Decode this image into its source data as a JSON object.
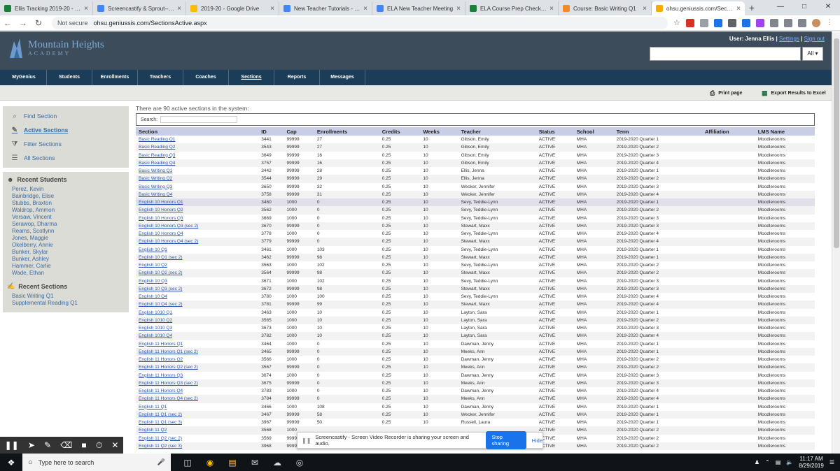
{
  "browser": {
    "tabs": [
      {
        "title": "Ellis Tracking 2019-20 - Go",
        "color": "#188038"
      },
      {
        "title": "Screencastify & Sprout--Wi",
        "color": "#4285f4"
      },
      {
        "title": "2019-20 - Google Drive",
        "color": "#fbbc04"
      },
      {
        "title": "New Teacher Tutorials - Go",
        "color": "#4285f4"
      },
      {
        "title": "ELA New Teacher Meeting",
        "color": "#4285f4"
      },
      {
        "title": "ELA Course Prep Checkoff",
        "color": "#188038"
      },
      {
        "title": "Course: Basic Writing Q1",
        "color": "#f28b27"
      },
      {
        "title": "ohsu.geniussis.com/Section",
        "color": "#f9ab00"
      }
    ],
    "not_secure": "Not secure",
    "url": "ohsu.geniussis.com/SectionsActive.aspx"
  },
  "header": {
    "logo_line1": "Mountain Heights",
    "logo_line2": "ACADEMY",
    "user_label": "User: Jenna Ellis |",
    "settings": "Settings",
    "sign_out": "Sign out",
    "search_scope": "All ▾"
  },
  "nav": [
    "MyGenius",
    "Students",
    "Enrollments",
    "Teachers",
    "Coaches",
    "Sections",
    "Reports",
    "Messages"
  ],
  "toolbar": {
    "print": "Print page",
    "export": "Export Results to Excel"
  },
  "sidebar": {
    "links": [
      {
        "label": "Find Section",
        "icon": "search-icon"
      },
      {
        "label": "Active Sections",
        "icon": "pencil-icon"
      },
      {
        "label": "Filter Sections",
        "icon": "filter-icon"
      },
      {
        "label": "All Sections",
        "icon": "list-icon"
      }
    ],
    "recent_students_title": "Recent Students",
    "recent_students": [
      "Perez, Kevin",
      "Bainbridge, Elise",
      "Stubbs, Braxton",
      "Waldrop, Ammon",
      "Versaw, Vincent",
      "Serawop, Dharma",
      "Reams, Scotlynn",
      "Jones, Maggie",
      "Okelberry, Annie",
      "Bunker, Skylar",
      "Bunker, Ashley",
      "Hammer, Carlie",
      "Wade, Ethan"
    ],
    "recent_sections_title": "Recent Sections",
    "recent_sections": [
      "Basic Writing Q1",
      "Supplemental Reading Q1"
    ]
  },
  "main": {
    "count_text": "There are 90 active sections in the system:",
    "search_label": "Search:",
    "columns": [
      "Section",
      "ID",
      "Cap",
      "Enrollments",
      "Credits",
      "Weeks",
      "Teacher",
      "Status",
      "School",
      "Term",
      "Affiliation",
      "LMS Name"
    ],
    "rows": [
      [
        "Basic Reading Q1",
        "3441",
        "99999",
        "27",
        "0.25",
        "10",
        "Gibson, Emily",
        "ACTIVE",
        "MHA",
        "2019-2020 Quarter 1",
        "",
        "Moodlerooms"
      ],
      [
        "Basic Reading Q2",
        "3543",
        "99999",
        "27",
        "0.25",
        "10",
        "Gibson, Emily",
        "ACTIVE",
        "MHA",
        "2019-2020 Quarter 2",
        "",
        "Moodlerooms"
      ],
      [
        "Basic Reading Q3",
        "3649",
        "99999",
        "16",
        "0.25",
        "10",
        "Gibson, Emily",
        "ACTIVE",
        "MHA",
        "2019-2020 Quarter 3",
        "",
        "Moodlerooms"
      ],
      [
        "Basic Reading Q4",
        "3757",
        "99999",
        "16",
        "0.25",
        "10",
        "Gibson, Emily",
        "ACTIVE",
        "MHA",
        "2019-2020 Quarter 4",
        "",
        "Moodlerooms"
      ],
      [
        "Basic Writing Q1",
        "3442",
        "99999",
        "28",
        "0.25",
        "10",
        "Ellis, Jenna",
        "ACTIVE",
        "MHA",
        "2019-2020 Quarter 1",
        "",
        "Moodlerooms"
      ],
      [
        "Basic Writing Q2",
        "3544",
        "99999",
        "29",
        "0.25",
        "10",
        "Ellis, Jenna",
        "ACTIVE",
        "MHA",
        "2019-2020 Quarter 2",
        "",
        "Moodlerooms"
      ],
      [
        "Basic Writing Q3",
        "3650",
        "99999",
        "32",
        "0.25",
        "10",
        "Wecker, Jennifer",
        "ACTIVE",
        "MHA",
        "2019-2020 Quarter 3",
        "",
        "Moodlerooms"
      ],
      [
        "Basic Writing Q4",
        "3758",
        "99999",
        "31",
        "0.25",
        "10",
        "Wecker, Jennifer",
        "ACTIVE",
        "MHA",
        "2019-2020 Quarter 4",
        "",
        "Moodlerooms"
      ],
      [
        "English 10 Honors Q1",
        "3460",
        "1000",
        "0",
        "0.25",
        "10",
        "Sevy, Teddie-Lynn",
        "ACTIVE",
        "MHA",
        "2019-2020 Quarter 1",
        "",
        "Moodlerooms"
      ],
      [
        "English 10 Honors Q2",
        "3562",
        "1000",
        "0",
        "0.25",
        "10",
        "Sevy, Teddie-Lynn",
        "ACTIVE",
        "MHA",
        "2019-2020 Quarter 2",
        "",
        "Moodlerooms"
      ],
      [
        "English 10 Honors Q3",
        "3669",
        "1000",
        "0",
        "0.25",
        "10",
        "Sevy, Teddie-Lynn",
        "ACTIVE",
        "MHA",
        "2019-2020 Quarter 3",
        "",
        "Moodlerooms"
      ],
      [
        "English 10 Honors Q3 (sec 2)",
        "3670",
        "99999",
        "0",
        "0.25",
        "10",
        "Stewart, Maxx",
        "ACTIVE",
        "MHA",
        "2019-2020 Quarter 3",
        "",
        "Moodlerooms"
      ],
      [
        "English 10 Honors Q4",
        "3778",
        "1000",
        "0",
        "0.25",
        "10",
        "Sevy, Teddie-Lynn",
        "ACTIVE",
        "MHA",
        "2019-2020 Quarter 4",
        "",
        "Moodlerooms"
      ],
      [
        "English 10 Honors Q4 (sec 2)",
        "3779",
        "99999",
        "0",
        "0.25",
        "10",
        "Stewart, Maxx",
        "ACTIVE",
        "MHA",
        "2019-2020 Quarter 4",
        "",
        "Moodlerooms"
      ],
      [
        "English 10 Q1",
        "3461",
        "1000",
        "103",
        "0.25",
        "10",
        "Sevy, Teddie-Lynn",
        "ACTIVE",
        "MHA",
        "2019-2020 Quarter 1",
        "",
        "Moodlerooms"
      ],
      [
        "English 10 Q1 (sec 2)",
        "3462",
        "99999",
        "98",
        "0.25",
        "10",
        "Stewart, Maxx",
        "ACTIVE",
        "MHA",
        "2019-2020 Quarter 1",
        "",
        "Moodlerooms"
      ],
      [
        "English 10 Q2",
        "3563",
        "1000",
        "102",
        "0.25",
        "10",
        "Sevy, Teddie-Lynn",
        "ACTIVE",
        "MHA",
        "2019-2020 Quarter 2",
        "",
        "Moodlerooms"
      ],
      [
        "English 10 Q2 (sec 2)",
        "3564",
        "99999",
        "98",
        "0.25",
        "10",
        "Stewart, Maxx",
        "ACTIVE",
        "MHA",
        "2019-2020 Quarter 2",
        "",
        "Moodlerooms"
      ],
      [
        "English 10 Q3",
        "3671",
        "1000",
        "102",
        "0.25",
        "10",
        "Sevy, Teddie-Lynn",
        "ACTIVE",
        "MHA",
        "2019-2020 Quarter 3",
        "",
        "Moodlerooms"
      ],
      [
        "English 10 Q3 (sec 2)",
        "3672",
        "99999",
        "98",
        "0.25",
        "10",
        "Stewart, Maxx",
        "ACTIVE",
        "MHA",
        "2019-2020 Quarter 3",
        "",
        "Moodlerooms"
      ],
      [
        "English 10 Q4",
        "3780",
        "1000",
        "100",
        "0.25",
        "10",
        "Sevy, Teddie-Lynn",
        "ACTIVE",
        "MHA",
        "2019-2020 Quarter 4",
        "",
        "Moodlerooms"
      ],
      [
        "English 10 Q4 (sec 2)",
        "3781",
        "99999",
        "99",
        "0.25",
        "10",
        "Stewart, Maxx",
        "ACTIVE",
        "MHA",
        "2019-2020 Quarter 4",
        "",
        "Moodlerooms"
      ],
      [
        "English 1010 Q1",
        "3463",
        "1000",
        "10",
        "0.25",
        "10",
        "Layton, Sara",
        "ACTIVE",
        "MHA",
        "2019-2020 Quarter 1",
        "",
        "Moodlerooms"
      ],
      [
        "English 1010 Q2",
        "3565",
        "1000",
        "10",
        "0.25",
        "10",
        "Layton, Sara",
        "ACTIVE",
        "MHA",
        "2019-2020 Quarter 2",
        "",
        "Moodlerooms"
      ],
      [
        "English 1010 Q3",
        "3673",
        "1000",
        "10",
        "0.25",
        "10",
        "Layton, Sara",
        "ACTIVE",
        "MHA",
        "2019-2020 Quarter 3",
        "",
        "Moodlerooms"
      ],
      [
        "English 1010 Q4",
        "3782",
        "1000",
        "10",
        "0.25",
        "10",
        "Layton, Sara",
        "ACTIVE",
        "MHA",
        "2019-2020 Quarter 4",
        "",
        "Moodlerooms"
      ],
      [
        "English 11 Honors Q1",
        "3464",
        "1000",
        "0",
        "0.25",
        "10",
        "Dawman, Jenny",
        "ACTIVE",
        "MHA",
        "2019-2020 Quarter 1",
        "",
        "Moodlerooms"
      ],
      [
        "English 11 Honors Q1 (sec 2)",
        "3465",
        "99999",
        "0",
        "0.25",
        "10",
        "Meeks, Ann",
        "ACTIVE",
        "MHA",
        "2019-2020 Quarter 1",
        "",
        "Moodlerooms"
      ],
      [
        "English 11 Honors Q2",
        "3566",
        "1000",
        "0",
        "0.25",
        "10",
        "Dawman, Jenny",
        "ACTIVE",
        "MHA",
        "2019-2020 Quarter 2",
        "",
        "Moodlerooms"
      ],
      [
        "English 11 Honors Q2 (sec 2)",
        "3567",
        "99999",
        "0",
        "0.25",
        "10",
        "Meeks, Ann",
        "ACTIVE",
        "MHA",
        "2019-2020 Quarter 2",
        "",
        "Moodlerooms"
      ],
      [
        "English 11 Honors Q3",
        "3674",
        "1000",
        "0",
        "0.25",
        "10",
        "Dawman, Jenny",
        "ACTIVE",
        "MHA",
        "2019-2020 Quarter 3",
        "",
        "Moodlerooms"
      ],
      [
        "English 11 Honors Q3 (sec 2)",
        "3675",
        "99999",
        "0",
        "0.25",
        "10",
        "Meeks, Ann",
        "ACTIVE",
        "MHA",
        "2019-2020 Quarter 3",
        "",
        "Moodlerooms"
      ],
      [
        "English 11 Honors Q4",
        "3783",
        "1000",
        "0",
        "0.25",
        "10",
        "Dawman, Jenny",
        "ACTIVE",
        "MHA",
        "2019-2020 Quarter 4",
        "",
        "Moodlerooms"
      ],
      [
        "English 11 Honors Q4 (sec 2)",
        "3784",
        "99999",
        "0",
        "0.25",
        "10",
        "Meeks, Ann",
        "ACTIVE",
        "MHA",
        "2019-2020 Quarter 4",
        "",
        "Moodlerooms"
      ],
      [
        "English 11 Q1",
        "3466",
        "1000",
        "108",
        "0.25",
        "10",
        "Dawman, Jenny",
        "ACTIVE",
        "MHA",
        "2019-2020 Quarter 1",
        "",
        "Moodlerooms"
      ],
      [
        "English 11 Q1 (sec 2)",
        "3467",
        "99999",
        "58",
        "0.25",
        "10",
        "Wecker, Jennifer",
        "ACTIVE",
        "MHA",
        "2019-2020 Quarter 1",
        "",
        "Moodlerooms"
      ],
      [
        "English 11 Q1 (sec 3)",
        "3967",
        "99999",
        "50",
        "0.25",
        "10",
        "Russell, Laura",
        "ACTIVE",
        "MHA",
        "2019-2020 Quarter 1",
        "",
        "Moodlerooms"
      ],
      [
        "English 11 Q2",
        "3568",
        "1000",
        "",
        "",
        "",
        "",
        "ACTIVE",
        "MHA",
        "2019-2020 Quarter 2",
        "",
        "Moodlerooms"
      ],
      [
        "English 11 Q2 (sec 2)",
        "3569",
        "99999",
        "",
        "",
        "",
        "",
        "ACTIVE",
        "MHA",
        "2019-2020 Quarter 2",
        "",
        "Moodlerooms"
      ],
      [
        "English 11 Q2 (sec 3)",
        "3968",
        "99999",
        "",
        "",
        "",
        "",
        "ACTIVE",
        "MHA",
        "2019-2020 Quarter 2",
        "",
        "Moodlerooms"
      ]
    ]
  },
  "screencastify": {
    "message": "Screencastify - Screen Video Recorder is sharing your screen and audio.",
    "stop": "Stop sharing",
    "hide": "Hide"
  },
  "taskbar": {
    "search_placeholder": "Type here to search",
    "time": "11:17 AM",
    "date": "8/29/2019"
  }
}
